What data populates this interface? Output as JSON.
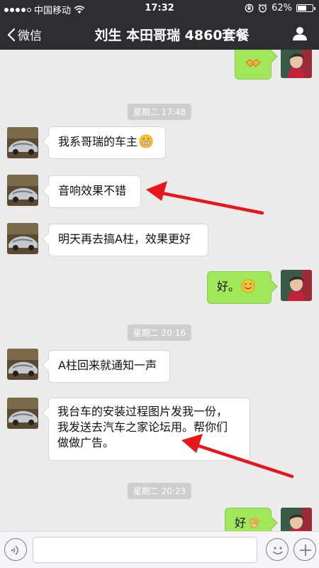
{
  "status_bar": {
    "carrier": "中国移动",
    "time": "17:32",
    "battery_percent": "62%",
    "battery_level": 0.62
  },
  "nav": {
    "back_label": "微信",
    "title": "刘生 本田哥瑞 4860套餐"
  },
  "timestamps": [
    "星期二 17:48",
    "星期二 20:16",
    "星期二 20:23"
  ],
  "messages": [
    {
      "from": "me",
      "text": "",
      "emoji": "handshake-icon"
    },
    {
      "from": "contact",
      "text": "我系哥瑞的车主",
      "emoji": "grin-icon"
    },
    {
      "from": "contact",
      "text": "音响效果不错"
    },
    {
      "from": "contact",
      "text": "明天再去搞A柱，效果更好"
    },
    {
      "from": "me",
      "text": "好。",
      "emoji": "smile-icon"
    },
    {
      "from": "contact",
      "text": "A柱回来就通知一声"
    },
    {
      "from": "contact",
      "lines": [
        "我台车的安装过程图片发我一份，",
        "我发送去汽车之家论坛用。帮你们",
        "做做广告。"
      ]
    },
    {
      "from": "me",
      "text": "好",
      "emoji": "ok-hand-icon"
    }
  ],
  "colors": {
    "header_bg": "#2e2e32",
    "chat_bg": "#ebebeb",
    "outgoing_bubble": "#a0e75a",
    "incoming_bubble": "#ffffff",
    "annotation_arrow": "#e8161a"
  }
}
